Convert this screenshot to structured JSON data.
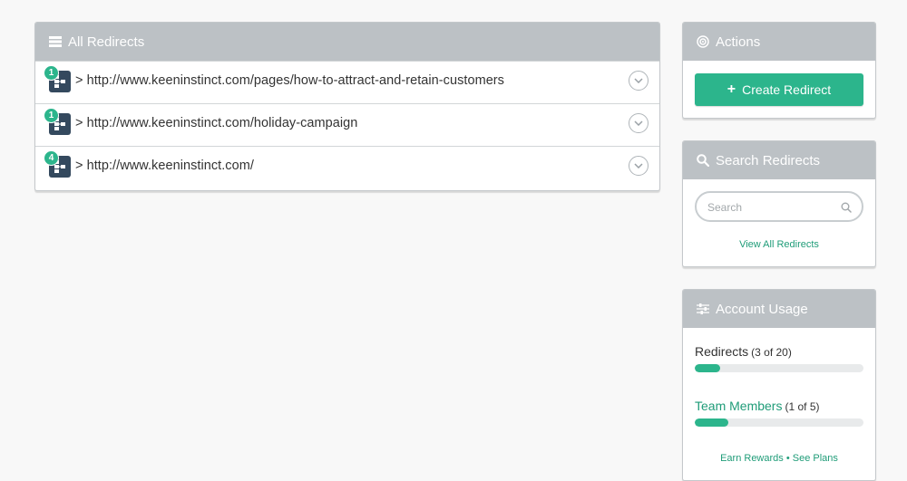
{
  "all_redirects": {
    "title": "All Redirects",
    "items": [
      {
        "count": "1",
        "url": "> http://www.keeninstinct.com/pages/how-to-attract-and-retain-customers"
      },
      {
        "count": "1",
        "url": "> http://www.keeninstinct.com/holiday-campaign"
      },
      {
        "count": "4",
        "url": "> http://www.keeninstinct.com/"
      }
    ]
  },
  "actions": {
    "title": "Actions",
    "create_label": "Create Redirect"
  },
  "search": {
    "title": "Search Redirects",
    "placeholder": "Search",
    "value": "",
    "view_all_label": "View All Redirects"
  },
  "account_usage": {
    "title": "Account Usage",
    "redirects_label": "Redirects",
    "redirects_count": "(3 of 20)",
    "redirects_fraction": 0.15,
    "team_label": "Team Members",
    "team_count": "(1 of 5)",
    "team_fraction": 0.2,
    "earn_label": "Earn Rewards",
    "separator": "•",
    "plans_label": "See Plans"
  },
  "colors": {
    "accent": "#2cb58c",
    "header": "#bcc1c5",
    "node_icon": "#34495e"
  }
}
